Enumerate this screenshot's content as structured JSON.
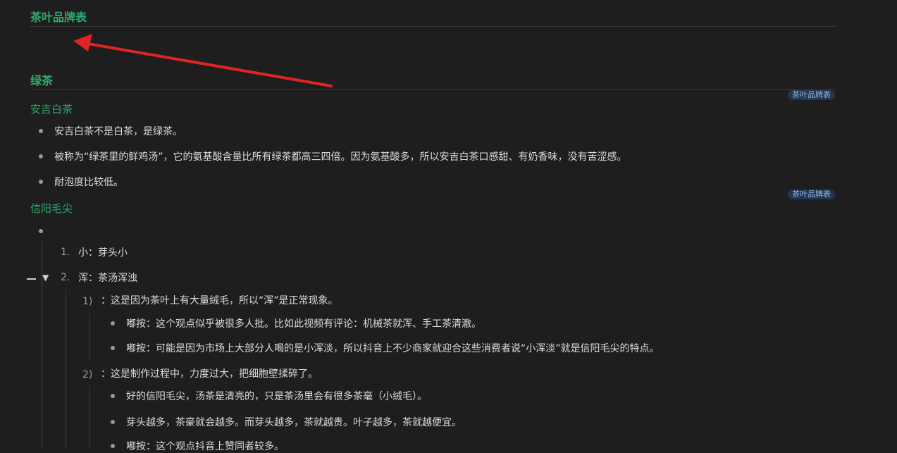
{
  "brand_title": "茶叶品牌表",
  "section_green": "绿茶",
  "tag_label": "茶叶品牌表",
  "anji": {
    "title": "安吉白茶",
    "items": [
      "安吉白茶不是白茶，是绿茶。",
      "被称为“绿茶里的鲜鸡汤”，它的氨基酸含量比所有绿茶都高三四倍。因为氨基酸多，所以安吉白茶口感甜、有奶香味，没有苦涩感。",
      "耐泡度比较低。"
    ]
  },
  "xinyang": {
    "title": "信阳毛尖",
    "ol": [
      {
        "num": "1.",
        "text": "小：芽头小"
      },
      {
        "num": "2.",
        "text": "浑：茶汤浑浊"
      }
    ],
    "sub1": {
      "num": "1)",
      "text": "：这是因为茶叶上有大量绒毛，所以“浑”是正常现象。"
    },
    "sub1_items": [
      "嘟按：这个观点似乎被很多人批。比如此视频有评论：机械茶就浑、手工茶清澈。",
      "嘟按：可能是因为市场上大部分人喝的是小浑淡，所以抖音上不少商家就迎合这些消费者说“小浑淡”就是信阳毛尖的特点。"
    ],
    "sub2": {
      "num": "2)",
      "text": "：这是制作过程中，力度过大，把细胞壁揉碎了。"
    },
    "sub2_items": [
      "好的信阳毛尖，汤茶是清亮的，只是茶汤里会有很多茶毫（小绒毛）。",
      "芽头越多，茶豪就会越多。而芽头越多，茶就越贵。叶子越多，茶就越便宜。",
      "嘟按：这个观点抖音上赞同者较多。"
    ]
  },
  "colors": {
    "heading": "#2fa86e",
    "arrow": "#e02424",
    "tag_bg": "#24364f"
  }
}
